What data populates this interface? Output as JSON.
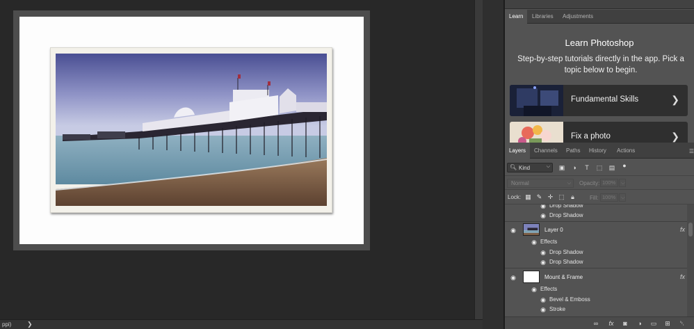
{
  "status_bar": {
    "text": "ppi)",
    "arrow": "❯"
  },
  "learn_panel": {
    "tabs": [
      {
        "label": "Learn"
      },
      {
        "label": "Libraries"
      },
      {
        "label": "Adjustments"
      }
    ],
    "title": "Learn Photoshop",
    "description": "Step-by-step tutorials directly in the app. Pick a topic below to begin.",
    "cards": [
      {
        "label": "Fundamental Skills"
      },
      {
        "label": "Fix a photo"
      }
    ]
  },
  "layers_panel": {
    "tabs": [
      {
        "label": "Layers"
      },
      {
        "label": "Channels"
      },
      {
        "label": "Paths"
      },
      {
        "label": "History"
      },
      {
        "label": "Actions"
      }
    ],
    "filter": {
      "kind_label": "Kind"
    },
    "blend_mode": "Normal",
    "opacity_label": "Opacity:",
    "opacity_value": "100%",
    "lock_label": "Lock:",
    "fill_label": "Fill:",
    "fill_value": "100%",
    "partial_effect_top": "Drop Shadow",
    "partial_effect_second": "Drop Shadow",
    "layers": [
      {
        "name": "Layer 0",
        "fx": "fx",
        "effects_label": "Effects",
        "effects": [
          "Drop Shadow",
          "Drop Shadow"
        ]
      },
      {
        "name": "Mount & Frame",
        "fx": "fx",
        "effects_label": "Effects",
        "effects": [
          "Bevel & Emboss",
          "Stroke"
        ]
      }
    ]
  }
}
